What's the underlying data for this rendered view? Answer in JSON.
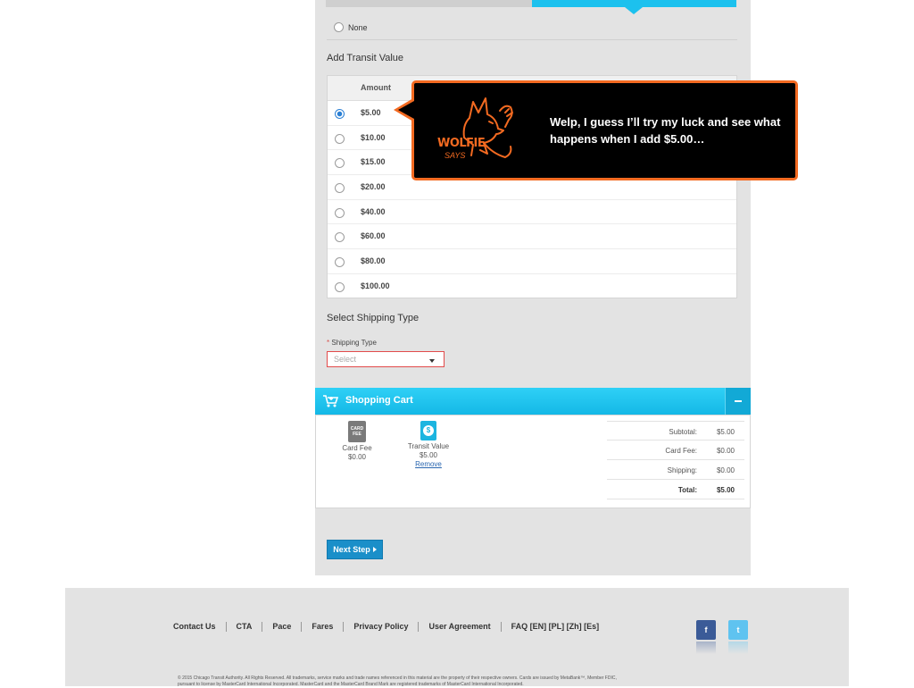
{
  "transit_options": {
    "none_label": "None"
  },
  "add_value": {
    "title": "Add Transit Value",
    "column_header": "Amount",
    "amounts": [
      "$5.00",
      "$10.00",
      "$15.00",
      "$20.00",
      "$40.00",
      "$60.00",
      "$80.00",
      "$100.00"
    ],
    "selected": "$5.00"
  },
  "shipping": {
    "title": "Select Shipping Type",
    "required_mark": "*",
    "field_label": "Shipping Type",
    "placeholder": "Select"
  },
  "cart": {
    "title": "Shopping Cart",
    "items": [
      {
        "icon": "card-fee-icon",
        "icon_text": "CARD FEE",
        "name": "Card Fee",
        "price": "$0.00"
      },
      {
        "icon": "dollar-icon",
        "icon_text": "$",
        "name": "Transit Value",
        "price": "$5.00",
        "action": "Remove"
      }
    ],
    "totals": [
      {
        "label": "Subtotal:",
        "value": "$5.00"
      },
      {
        "label": "Card Fee:",
        "value": "$0.00"
      },
      {
        "label": "Shipping:",
        "value": "$0.00"
      },
      {
        "label": "Total:",
        "value": "$5.00"
      }
    ]
  },
  "next_step_label": "Next Step",
  "callout": {
    "logo_line1": "WOLFIE",
    "logo_line2": "SAYS",
    "text": "Welp, I guess I’ll try my luck and see what happens when I add $5.00…"
  },
  "footer": {
    "links": [
      "Contact Us",
      "CTA",
      "Pace",
      "Fares",
      "Privacy Policy",
      "User Agreement",
      "FAQ [EN] [PL] [Zh] [Es]"
    ],
    "facebook": "f",
    "twitter": "t",
    "copyright_line1": "© 2015 Chicago Transit Authority. All Rights Reserved. All trademarks, service marks and trade names referenced in this material are the property of their respective owners. Cards are issued by MetaBank™, Member FDIC,",
    "copyright_line2": "pursuant to license by MasterCard International Incorporated. MasterCard and the MasterCard Brand Mark are registered trademarks of MasterCard International Incorporated."
  },
  "colors": {
    "accent": "#1cc1ee",
    "callout_border": "#f36a21",
    "button": "#1a8fc9",
    "error_border": "#e24b4b"
  }
}
